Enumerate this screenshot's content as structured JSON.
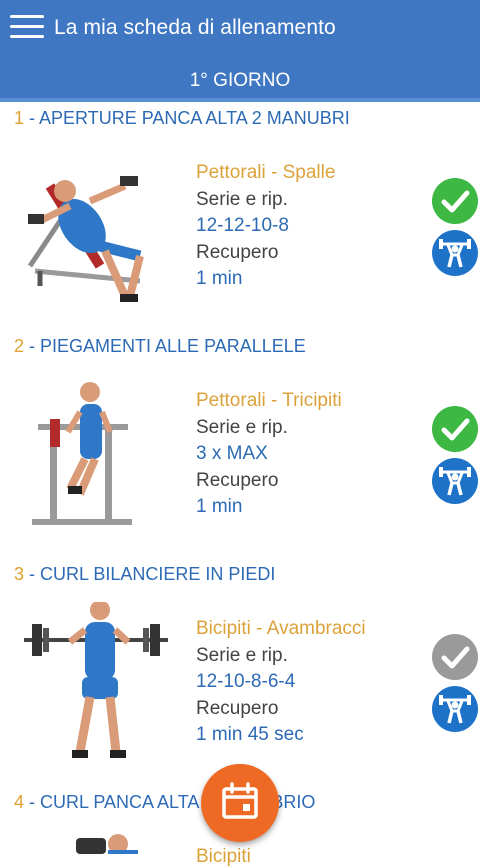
{
  "header": {
    "menu_icon": "hamburger-menu-icon",
    "title": "La mia scheda di allenamento",
    "day": "1° GIORNO",
    "color": "#3f77c3"
  },
  "exercises": [
    {
      "number": "1",
      "name": " - APERTURE PANCA ALTA 2 MANUBRI",
      "muscles": "Pettorali - Spalle",
      "sets_label": "Serie e rip.",
      "sets_value": "12-12-10-8",
      "rest_label": "Recupero",
      "rest_value": "1 min",
      "completed": true
    },
    {
      "number": "2",
      "name": " - PIEGAMENTI ALLE PARALLELE",
      "muscles": "Pettorali - Tricipiti",
      "sets_label": "Serie e rip.",
      "sets_value": "3 x MAX",
      "rest_label": "Recupero",
      "rest_value": "1 min",
      "completed": true
    },
    {
      "number": "3",
      "name": " - CURL BILANCIERE IN PIEDI",
      "muscles": "Bicipiti - Avambracci",
      "sets_label": "Serie e rip.",
      "sets_value": "12-10-8-6-4",
      "rest_label": "Recupero",
      "rest_value": "1 min 45 sec",
      "completed": false
    },
    {
      "number": "4",
      "name": " - CURL PANCA ALTA 1 MANUBRIO",
      "muscles": "Bicipiti",
      "completed": false
    }
  ],
  "icons": {
    "check": "check-icon",
    "lift": "weightlifter-icon",
    "fab": "calendar-icon"
  },
  "colors": {
    "accent_orange": "#ee6a24",
    "check_done": "#3cb843",
    "check_todo": "#9a9a9a",
    "lift_blue": "#1e73c8",
    "title_blue": "#2d6ab6",
    "muscle_gold": "#dca23a"
  }
}
